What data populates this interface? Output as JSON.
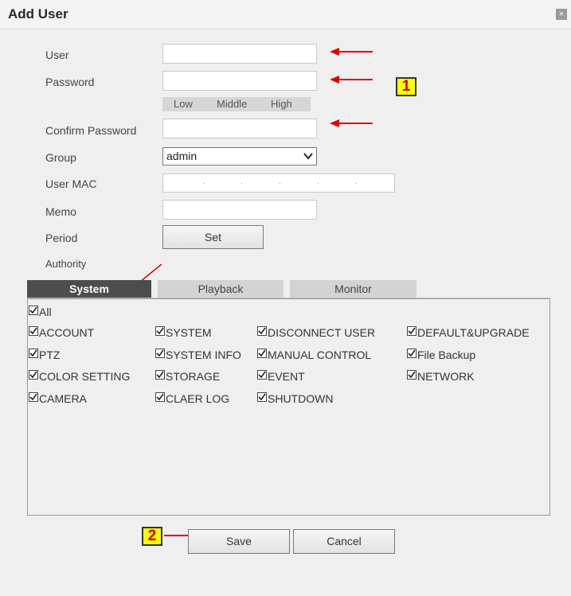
{
  "dialog": {
    "title": "Add User",
    "close_glyph": "×"
  },
  "form": {
    "user_label": "User",
    "user_value": "",
    "password_label": "Password",
    "password_value": "",
    "strength": {
      "low": "Low",
      "middle": "Middle",
      "high": "High"
    },
    "confirm_label": "Confirm Password",
    "confirm_value": "",
    "group_label": "Group",
    "group_value": "admin",
    "mac_label": "User MAC",
    "mac_separators": [
      ".",
      ".",
      ".",
      ".",
      "."
    ],
    "memo_label": "Memo",
    "memo_value": "",
    "period_label": "Period",
    "period_button": "Set",
    "authority_label": "Authority"
  },
  "tabs": [
    {
      "label": "System",
      "active": true
    },
    {
      "label": "Playback",
      "active": false
    },
    {
      "label": "Monitor",
      "active": false
    }
  ],
  "permissions": {
    "all": {
      "label": "All",
      "checked": true
    },
    "items": [
      {
        "label": "ACCOUNT",
        "checked": true
      },
      {
        "label": "SYSTEM",
        "checked": true
      },
      {
        "label": "DISCONNECT USER",
        "checked": true
      },
      {
        "label": "DEFAULT&UPGRADE",
        "checked": true
      },
      {
        "label": "PTZ",
        "checked": true
      },
      {
        "label": "SYSTEM INFO",
        "checked": true
      },
      {
        "label": "MANUAL CONTROL",
        "checked": true
      },
      {
        "label": "File Backup",
        "checked": true
      },
      {
        "label": "COLOR SETTING",
        "checked": true
      },
      {
        "label": "STORAGE",
        "checked": true
      },
      {
        "label": "EVENT",
        "checked": true
      },
      {
        "label": "NETWORK",
        "checked": true
      },
      {
        "label": "CAMERA",
        "checked": true
      },
      {
        "label": "CLAER LOG",
        "checked": true
      },
      {
        "label": "SHUTDOWN",
        "checked": true
      }
    ]
  },
  "buttons": {
    "save": "Save",
    "cancel": "Cancel"
  },
  "annotations": {
    "badge1": "1",
    "badge2": "2"
  },
  "colors": {
    "arrow": "#e00000",
    "badge_fill": "#ffff00",
    "badge_text": "#cc0000",
    "active_tab": "#4d4d4d"
  },
  "icons": {
    "close": "close-icon",
    "dropdown": "chevron-down-icon",
    "check": "checkmark-icon"
  }
}
